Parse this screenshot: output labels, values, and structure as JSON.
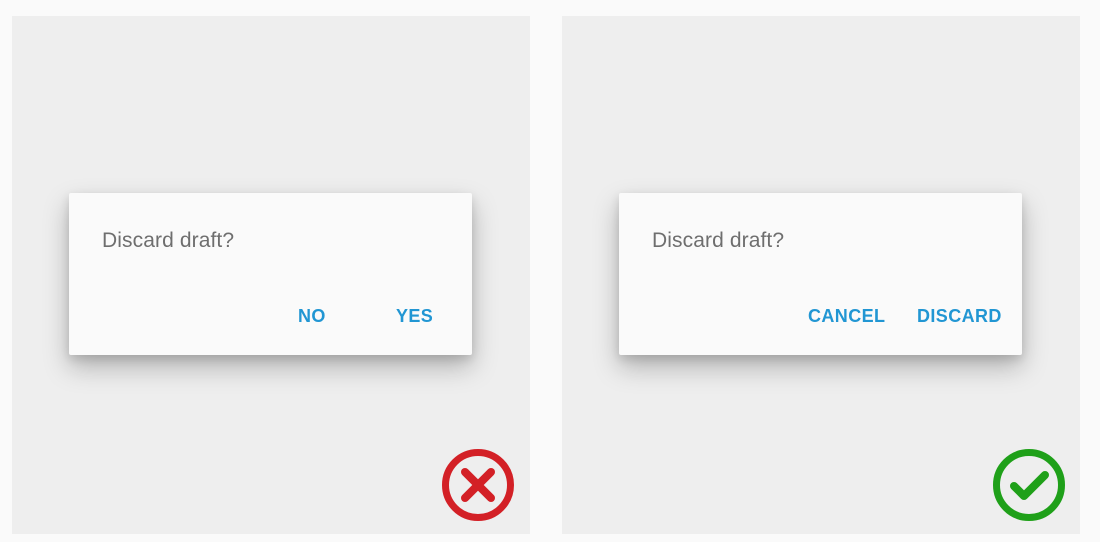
{
  "examples": [
    {
      "kind": "incorrect",
      "dialog": {
        "title": "Discard draft?",
        "buttons": [
          "NO",
          "YES"
        ]
      },
      "verdict_icon": "red-x-circle-icon",
      "verdict_color": "#d32026"
    },
    {
      "kind": "correct",
      "dialog": {
        "title": "Discard draft?",
        "buttons": [
          "CANCEL",
          "DISCARD"
        ]
      },
      "verdict_icon": "green-check-circle-icon",
      "verdict_color": "#1fa019"
    }
  ],
  "colors": {
    "page_background": "#fafafa",
    "panel_background": "#eeeeee",
    "dialog_background": "#fafafa",
    "title_text": "#6e6e6e",
    "button_text": "#2196d3"
  }
}
